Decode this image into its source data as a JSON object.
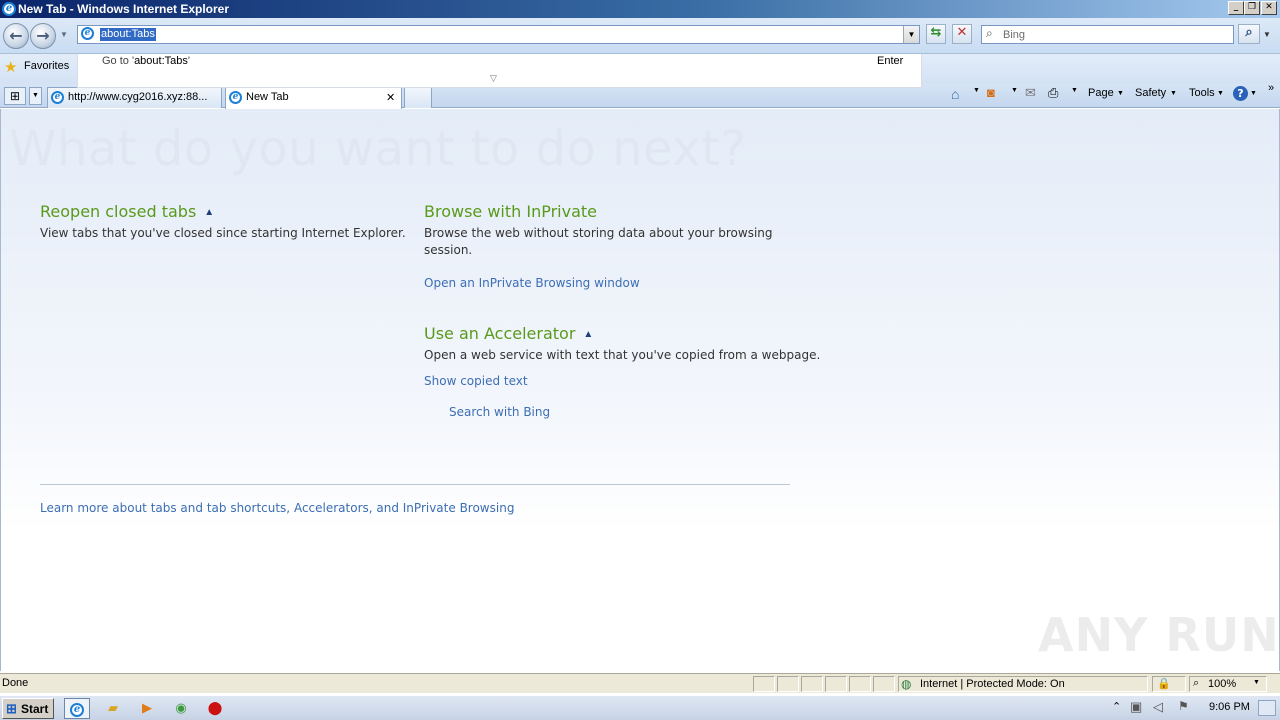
{
  "window": {
    "title": "New Tab - Windows Internet Explorer",
    "minimize": "_",
    "maximize": "❐",
    "close": "✕"
  },
  "address": {
    "value": "about:Tabs",
    "dropdown_prefix": "Go to '",
    "dropdown_value": "about:Tabs",
    "dropdown_suffix": "'",
    "dropdown_action": "Enter"
  },
  "search": {
    "placeholder": "Bing"
  },
  "favorites": {
    "label": "Favorites"
  },
  "tabs": [
    {
      "label": "http://www.cyg2016.xyz:88..."
    },
    {
      "label": "New Tab",
      "close": "✕"
    }
  ],
  "commandbar": {
    "page": "Page",
    "safety": "Safety",
    "tools": "Tools",
    "help": "?"
  },
  "content": {
    "heading": "What do you want to do next?",
    "reopen": {
      "title": "Reopen closed tabs",
      "text": "View tabs that you've closed since starting Internet Explorer."
    },
    "inprivate": {
      "title": "Browse with InPrivate",
      "text": "Browse the web without storing data about your browsing session.",
      "link": "Open an InPrivate Browsing window"
    },
    "accelerator": {
      "title": "Use an Accelerator",
      "text": "Open a web service with text that you've copied from a webpage.",
      "link": "Show copied text",
      "search": "Search with Bing"
    },
    "learn_more": "Learn more about tabs and tab shortcuts, Accelerators, and InPrivate Browsing"
  },
  "status": {
    "left": "Done",
    "zone": "Internet | Protected Mode: On",
    "zoom": "100%"
  },
  "taskbar": {
    "start": "Start",
    "clock": "9:06 PM"
  },
  "watermark": "ANY RUN",
  "colors": {
    "heading_green": "#5a9a1b",
    "link_blue": "#3c6eb4",
    "selection": "#316ac5"
  }
}
